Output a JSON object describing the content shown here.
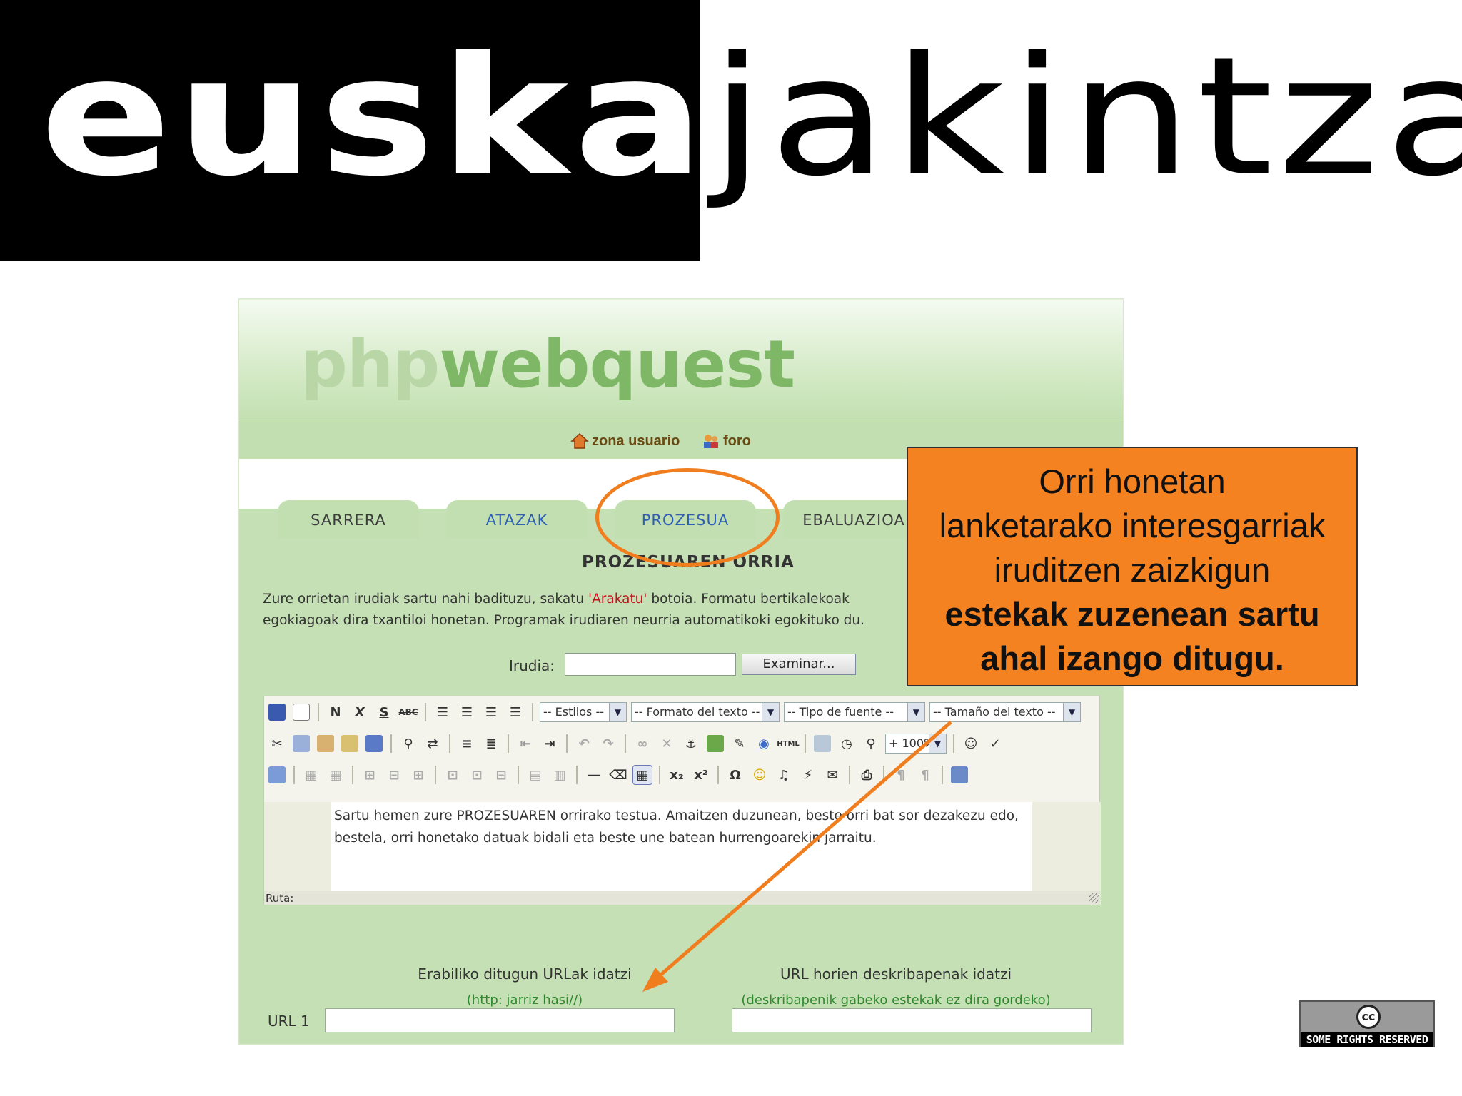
{
  "logo": {
    "left_word": "euskal",
    "right_word": "jakintza"
  },
  "screenshot": {
    "brand": {
      "part1": "php",
      "part2": "webquest"
    },
    "nav": {
      "link1": "zona usuario",
      "link2": "foro"
    },
    "tabs": [
      {
        "label": "SARRERA"
      },
      {
        "label": "ATAZAK"
      },
      {
        "label": "PROZESUA"
      },
      {
        "label": "EBALUAZIOA"
      }
    ],
    "page_heading": "PROZESUAREN ORRIA",
    "intro": {
      "part1": "Zure orrietan irudiak sartu nahi badituzu, sakatu ",
      "highlight": "'Arakatu'",
      "part2": " botoia. Formatu bertikalekoak",
      "line2": "egokiagoak dira txantiloi honetan. Programak irudiaren neurria automatikoki egokituko du."
    },
    "image_label": "Irudia:",
    "browse_button": "Examinar...",
    "editor": {
      "style_select": "-- Estilos --",
      "format_select": "-- Formato del texto --",
      "font_select": "-- Tipo de fuente --",
      "size_select": "-- Tamaño del texto --",
      "zoom_select": "+ 100%",
      "body_text": "Sartu hemen zure PROZESUAREN orrirako testua. Amaitzen duzunean, beste orri bat sor dezakezu edo, bestela, orri honetako datuak bidali eta beste une batean hurrengoarekin jarraitu.",
      "path_label": "Ruta:"
    },
    "url_column": {
      "heading": "Erabiliko ditugun URLak idatzi",
      "hint": "(http: jarriz hasi//)"
    },
    "desc_column": {
      "heading": "URL horien deskribapenak idatzi",
      "hint": "(deskribapenik gabeko estekak ez dira gordeko)"
    },
    "url_label": "URL 1"
  },
  "callout": {
    "line1": "Orri honetan",
    "line2": "lanketarako interesgarriak",
    "line3": "iruditzen zaizkigun",
    "bold_line1": "estekak zuzenean sartu",
    "bold_line2": "ahal izango ditugu."
  },
  "license": {
    "symbol": "cc",
    "text": "SOME RIGHTS RESERVED"
  },
  "colors": {
    "accent_orange": "#f58220",
    "panel_green": "#c4e0b4",
    "brand_green": "#7eb866"
  }
}
